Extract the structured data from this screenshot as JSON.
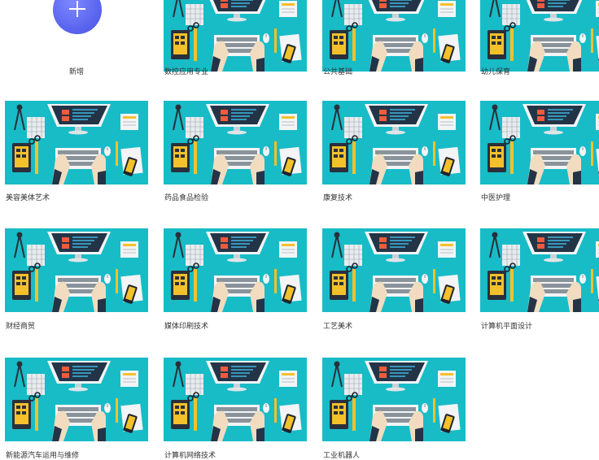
{
  "add_tile": {
    "label": "新增",
    "icon": "plus-icon"
  },
  "courses": [
    {
      "label": "数控应用专业",
      "variant": "short"
    },
    {
      "label": "公共基础",
      "variant": "short"
    },
    {
      "label": "幼儿保育",
      "variant": "short"
    },
    {
      "label": "美容美体艺术",
      "variant": "full"
    },
    {
      "label": "药品食品检验",
      "variant": "full"
    },
    {
      "label": "康复技术",
      "variant": "full"
    },
    {
      "label": "中医护理",
      "variant": "full"
    },
    {
      "label": "财经商贸",
      "variant": "full"
    },
    {
      "label": "媒体印刷技术",
      "variant": "full"
    },
    {
      "label": "工艺美术",
      "variant": "full"
    },
    {
      "label": "计算机平面设计",
      "variant": "full"
    },
    {
      "label": "新能源汽车运用与维修",
      "variant": "full"
    },
    {
      "label": "计算机网络技术",
      "variant": "full"
    },
    {
      "label": "工业机器人",
      "variant": "full"
    }
  ],
  "colors": {
    "tile_background": "#17bcc7",
    "add_button": "#5b66f0",
    "label_text": "#333333"
  }
}
